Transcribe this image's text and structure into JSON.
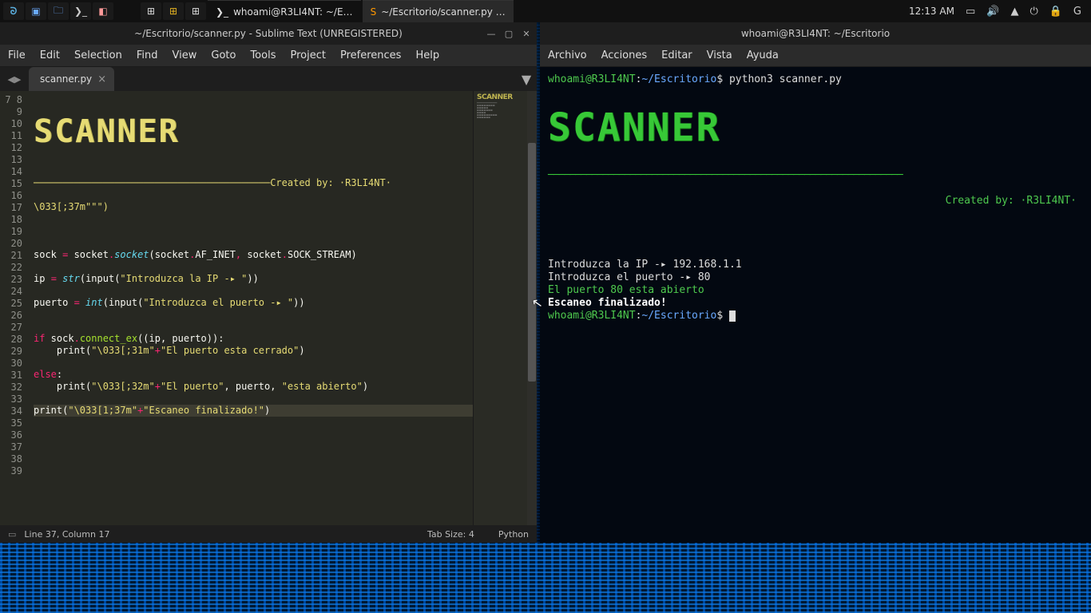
{
  "panel": {
    "tasks": [
      {
        "icon": "⌨",
        "label": ""
      },
      {
        "icon": "⌨",
        "label": ""
      },
      {
        "icon": "⌨",
        "label": ""
      },
      {
        "icon": "❯_",
        "label": "whoami@R3LI4NT: ~/E…"
      },
      {
        "icon": "S",
        "label": "~/Escritorio/scanner.py …"
      }
    ],
    "time": "12:13 AM"
  },
  "sublime": {
    "title": "~/Escritorio/scanner.py - Sublime Text (UNREGISTERED)",
    "menus": [
      "File",
      "Edit",
      "Selection",
      "Find",
      "View",
      "Goto",
      "Tools",
      "Project",
      "Preferences",
      "Help"
    ],
    "tab": "scanner.py",
    "line_start": 7,
    "line_end": 39,
    "ascii": "█▀▀▀ █▀▀▀ █▀▀█ █▄ █ █▄ █ █▀▀▀ █▀▀█\n▀▀▀█ █    █▄▄█ █ ▀█ █ ▀█ █▀▀  █▄▄▀\n▀▀▀▀ ▀▀▀▀ ▀  ▀ ▀  ▀ ▀  ▀ ▀▀▀▀ ▀ ▀▀",
    "created_line": "─────────────────────────────────────────Created by: ·R3LI4NT·",
    "code_l20": "\\033[;37m\"\"\")",
    "code_l24": "sock = socket.socket(socket.AF_INET, socket.SOCK_STREAM)",
    "code_l26_a": "ip = ",
    "code_l26_b": "str",
    "code_l26_c": "(input(",
    "code_l26_d": "\"Introduzca la IP -▸ \"",
    "code_l26_e": "))",
    "code_l28_a": "puerto = ",
    "code_l28_b": "int",
    "code_l28_c": "(input(",
    "code_l28_d": "\"Introduzca el puerto -▸ \"",
    "code_l28_e": "))",
    "code_l31_a": "if",
    "code_l31_b": " sock.connect_ex((ip, puerto)):",
    "code_l32_a": "    print(",
    "code_l32_b": "\"\\033[;31m\"",
    "code_l32_c": "+",
    "code_l32_d": "\"El puerto esta cerrado\"",
    "code_l32_e": ")",
    "code_l34": "else",
    "code_l35_a": "    print(",
    "code_l35_b": "\"\\033[;32m\"",
    "code_l35_c": "+",
    "code_l35_d": "\"El puerto\"",
    "code_l35_e": ", puerto, ",
    "code_l35_f": "\"esta abierto\"",
    "code_l35_g": ")",
    "code_l37_a": "print(",
    "code_l37_b": "\"\\033[1;37m\"",
    "code_l37_c": "+",
    "code_l37_d": "\"Escaneo finalizado!\"",
    "code_l37_e": ")",
    "status_left": "Line 37, Column 17",
    "status_tab": "Tab Size: 4",
    "status_lang": "Python"
  },
  "terminal": {
    "title": "whoami@R3LI4NT: ~/Escritorio",
    "menus": [
      "Archivo",
      "Acciones",
      "Editar",
      "Vista",
      "Ayuda"
    ],
    "prompt_user": "whoami@R3LI4NT",
    "prompt_path": "~/Escritorio",
    "cmd": "python3 scanner.py",
    "created": "Created by: ·R3LI4NT·",
    "out1": "Introduzca la IP -▸ 192.168.1.1",
    "out2": "Introduzca el puerto -▸ 80",
    "out3": "El puerto 80 esta abierto",
    "out4": "Escaneo finalizado!",
    "hr": "─────────────────────────────────────────────────────────────────"
  }
}
